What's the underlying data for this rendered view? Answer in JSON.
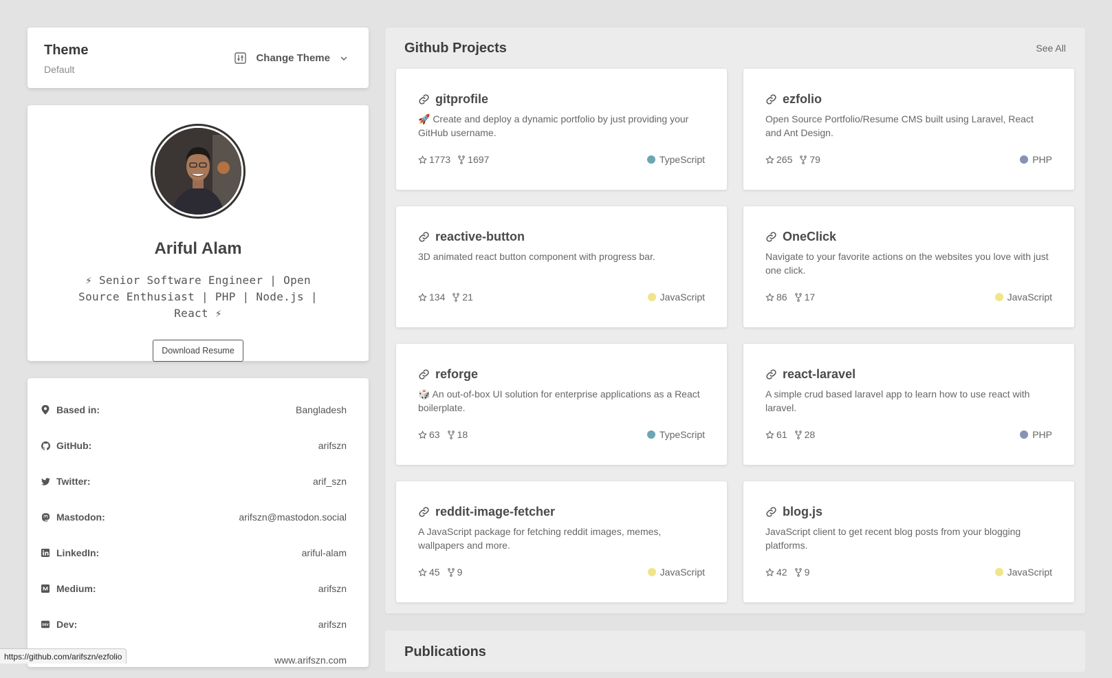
{
  "theme": {
    "title": "Theme",
    "subtitle": "Default",
    "button_label": "Change Theme"
  },
  "profile": {
    "name": "Ariful Alam",
    "bio": "⚡ Senior Software Engineer | Open Source Enthusiast | PHP | Node.js | React ⚡",
    "resume_label": "Download Resume"
  },
  "details": [
    {
      "icon": "location-pin-icon",
      "label": "Based in:",
      "value": "Bangladesh"
    },
    {
      "icon": "github-icon",
      "label": "GitHub:",
      "value": "arifszn"
    },
    {
      "icon": "twitter-icon",
      "label": "Twitter:",
      "value": "arif_szn"
    },
    {
      "icon": "mastodon-icon",
      "label": "Mastodon:",
      "value": "arifszn@mastodon.social"
    },
    {
      "icon": "linkedin-icon",
      "label": "LinkedIn:",
      "value": "ariful-alam"
    },
    {
      "icon": "medium-icon",
      "label": "Medium:",
      "value": "arifszn"
    },
    {
      "icon": "dev-icon",
      "label": "Dev:",
      "value": "arifszn"
    },
    {
      "icon": "globe-icon",
      "label": "",
      "value": "www.arifszn.com"
    }
  ],
  "projects_section": {
    "title": "Github Projects",
    "see_all": "See All"
  },
  "projects": [
    {
      "name": "gitprofile",
      "description": "🚀 Create and deploy a dynamic portfolio by just providing your GitHub username.",
      "stars": "1773",
      "forks": "1697",
      "language": "TypeScript",
      "lang_color": "#6ea5b3"
    },
    {
      "name": "ezfolio",
      "description": "Open Source Portfolio/Resume CMS built using Laravel, React and Ant Design.",
      "stars": "265",
      "forks": "79",
      "language": "PHP",
      "lang_color": "#8892b5"
    },
    {
      "name": "reactive-button",
      "description": "3D animated react button component with progress bar.",
      "stars": "134",
      "forks": "21",
      "language": "JavaScript",
      "lang_color": "#f1e58a"
    },
    {
      "name": "OneClick",
      "description": "Navigate to your favorite actions on the websites you love with just one click.",
      "stars": "86",
      "forks": "17",
      "language": "JavaScript",
      "lang_color": "#f1e58a"
    },
    {
      "name": "reforge",
      "description": "🎲 An out-of-box UI solution for enterprise applications as a React boilerplate.",
      "stars": "63",
      "forks": "18",
      "language": "TypeScript",
      "lang_color": "#6ea5b3"
    },
    {
      "name": "react-laravel",
      "description": "A simple crud based laravel app to learn how to use react with laravel.",
      "stars": "61",
      "forks": "28",
      "language": "PHP",
      "lang_color": "#8892b5"
    },
    {
      "name": "reddit-image-fetcher",
      "description": "A JavaScript package for fetching reddit images, memes, wallpapers and more.",
      "stars": "45",
      "forks": "9",
      "language": "JavaScript",
      "lang_color": "#f1e58a"
    },
    {
      "name": "blog.js",
      "description": "JavaScript client to get recent blog posts from your blogging platforms.",
      "stars": "42",
      "forks": "9",
      "language": "JavaScript",
      "lang_color": "#f1e58a"
    }
  ],
  "publications": {
    "title": "Publications"
  },
  "status_bar": {
    "url": "https://github.com/arifszn/ezfolio"
  }
}
